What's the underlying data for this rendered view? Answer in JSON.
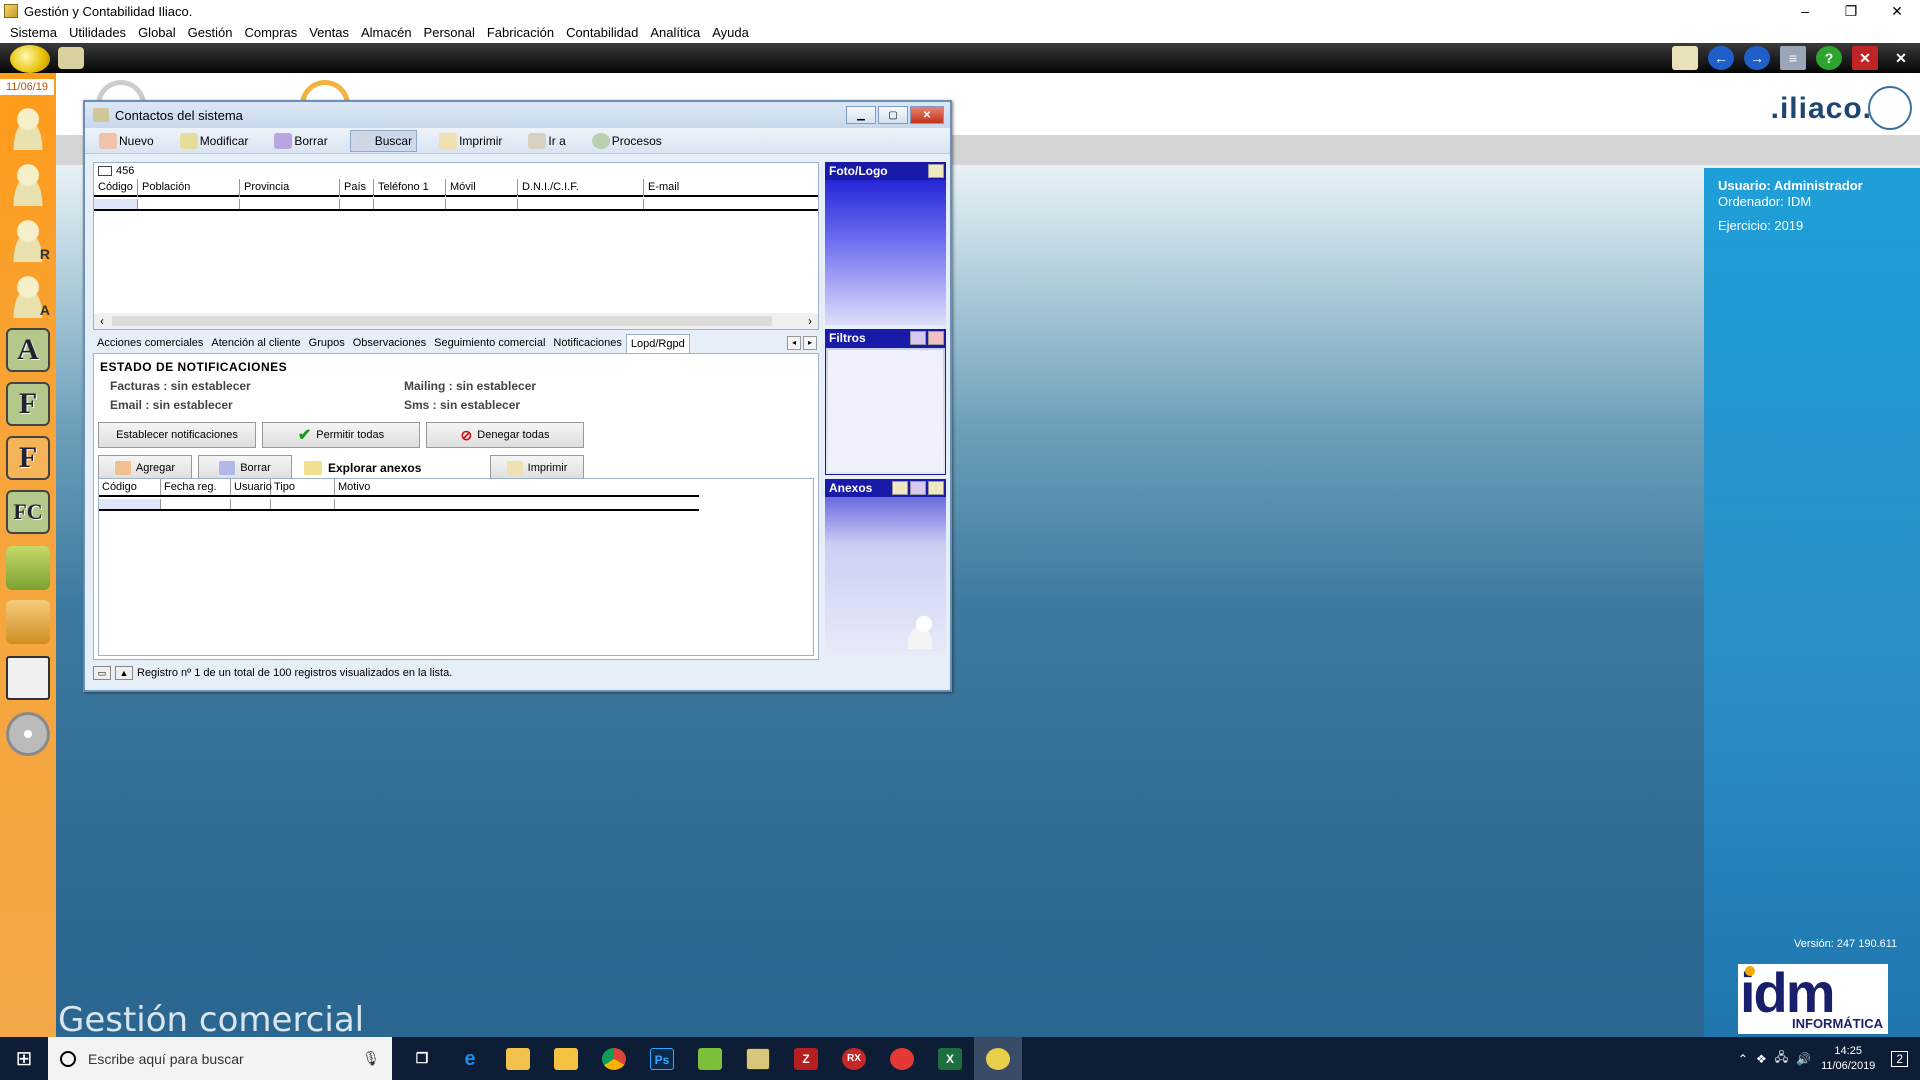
{
  "window": {
    "title": "Gestión y Contabilidad Iliaco.",
    "controls": [
      "–",
      "❐",
      "✕"
    ]
  },
  "menu": [
    "Sistema",
    "Utilidades",
    "Global",
    "Gestión",
    "Compras",
    "Ventas",
    "Almacén",
    "Personal",
    "Fabricación",
    "Contabilidad",
    "Analítica",
    "Ayuda"
  ],
  "sidebar": {
    "date": "11/06/19",
    "letters": [
      "R",
      "A",
      "A",
      "F",
      "F",
      "FC"
    ]
  },
  "brand": {
    "iliaco": ".iliaco.",
    "user": "Usuario: Administrador",
    "computer": "Ordenador: IDM",
    "year": "Ejercicio: 2019",
    "version": "Versión: 247 190.611",
    "idm": "idm",
    "idm_sub": "INFORMÁTICA",
    "module": "Gestión comercial"
  },
  "dialog": {
    "title": "Contactos del sistema",
    "toolbar": [
      "Nuevo",
      "Modificar",
      "Borrar",
      "Buscar",
      "Imprimir",
      "Ir a",
      "Procesos"
    ],
    "record_count": "456",
    "columns": [
      "Código",
      "Población",
      "Provincia",
      "País",
      "Teléfono 1",
      "Móvil",
      "D.N.I./C.I.F.",
      "E-mail"
    ],
    "panels": {
      "foto": "Foto/Logo",
      "filtros": "Filtros",
      "anexos": "Anexos"
    },
    "tabs": [
      "Acciones comerciales",
      "Atención al cliente",
      "Grupos",
      "Observaciones",
      "Seguimiento comercial",
      "Notificaciones",
      "Lopd/Rgpd"
    ],
    "active_tab": "Lopd/Rgpd",
    "notif": {
      "title": "ESTADO DE NOTIFICACIONES",
      "facturas": "Facturas : sin establecer",
      "email": "Email : sin establecer",
      "mailing": "Mailing : sin establecer",
      "sms": "Sms : sin establecer",
      "btn_establecer": "Establecer notificaciones",
      "btn_permitir": "Permitir todas",
      "btn_denegar": "Denegar todas",
      "btn_agregar": "Agregar",
      "btn_borrar": "Borrar",
      "btn_explorar": "Explorar anexos",
      "btn_imprimir": "Imprimir",
      "sub_columns": [
        "Código",
        "Fecha reg.",
        "Usuario",
        "Tipo",
        "Motivo"
      ]
    },
    "status": "Registro nº 1 de un total de 100 registros visualizados en la lista."
  },
  "taskbar": {
    "search_placeholder": "Escribe aquí para buscar",
    "time": "14:25",
    "date": "11/06/2019",
    "notifications": "2"
  }
}
